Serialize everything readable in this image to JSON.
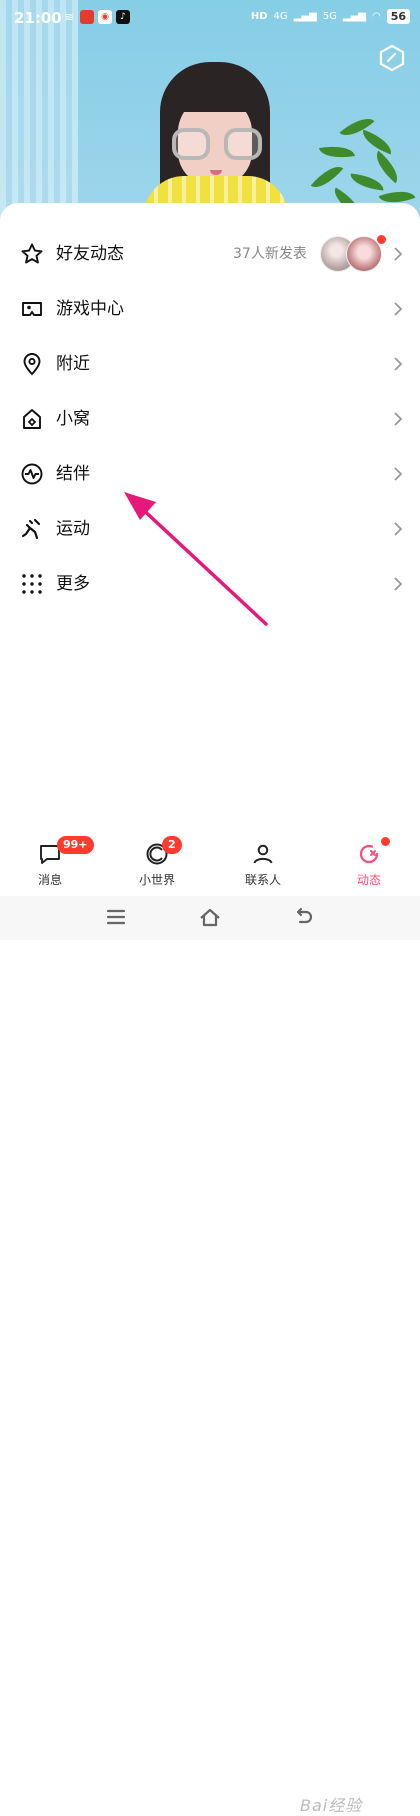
{
  "status_bar": {
    "time": "21:00",
    "network_left": "HD",
    "net_4g": "4G",
    "net_5g": "5G",
    "battery": "56"
  },
  "menu": {
    "items": [
      {
        "label": "好友动态",
        "icon": "star-icon",
        "subtitle": "37人新发表"
      },
      {
        "label": "游戏中心",
        "icon": "game-icon"
      },
      {
        "label": "附近",
        "icon": "location-pin-icon"
      },
      {
        "label": "小窝",
        "icon": "home-icon"
      },
      {
        "label": "结伴",
        "icon": "companion-icon"
      },
      {
        "label": "运动",
        "icon": "running-icon"
      },
      {
        "label": "更多",
        "icon": "grid-icon"
      }
    ]
  },
  "bottom_nav": {
    "tabs": [
      {
        "label": "消息",
        "icon": "message-icon",
        "badge": "99+"
      },
      {
        "label": "小世界",
        "icon": "world-icon",
        "badge": "2"
      },
      {
        "label": "联系人",
        "icon": "contacts-icon"
      },
      {
        "label": "动态",
        "icon": "dynamic-icon",
        "active": true
      }
    ]
  },
  "watermark": "Bai经验",
  "colors": {
    "accent": "#ff4d7a",
    "badge": "#ff3b30",
    "annotation_arrow": "#e6197a",
    "hero_sky": "#8ecfe8"
  }
}
